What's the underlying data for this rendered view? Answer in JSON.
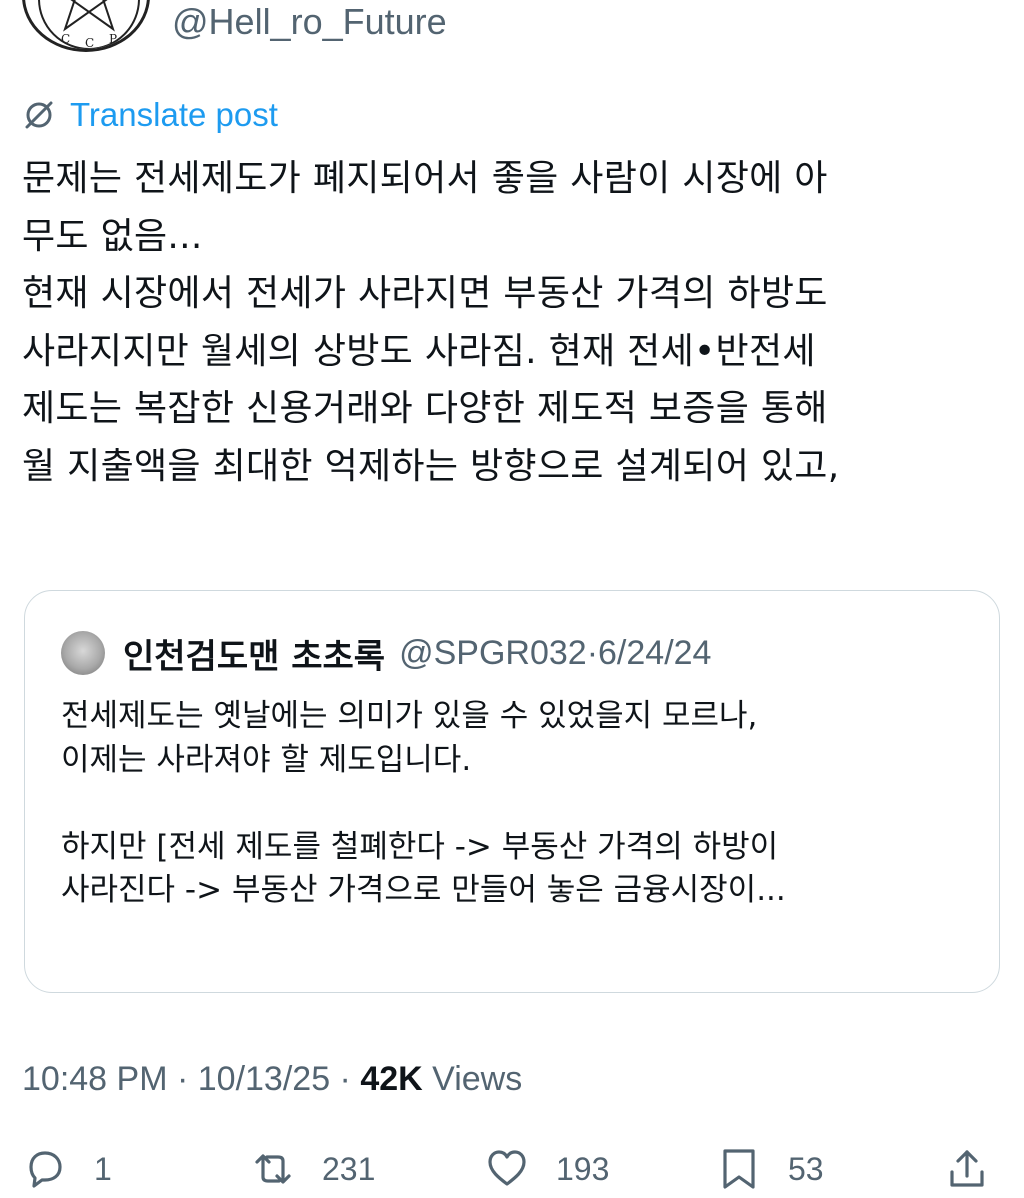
{
  "author": {
    "handle": "@Hell_ro_Future",
    "avatar_letters": [
      "C",
      "C",
      "P"
    ]
  },
  "translate_label": "Translate post",
  "post_text": "문제는 전세제도가 폐지되어서 좋을 사람이 시장에 아\n무도 없음...\n현재 시장에서 전세가 사라지면 부동산 가격의 하방도\n사라지지만 월세의 상방도 사라짐. 현재 전세•반전세\n제도는 복잡한 신용거래와 다양한 제도적 보증을 통해\n월 지출액을 최대한 억제하는 방향으로 설계되어 있고,",
  "quote": {
    "name": "인천검도맨 초초록",
    "handle": "@SPGR032",
    "date": "6/24/24",
    "separator": " · ",
    "text": "전세제도는 옛날에는 의미가 있을 수 있었을지 모르나,\n이제는 사라져야 할 제도입니다.\n\n하지만 [전세 제도를 철폐한다 -> 부동산 가격의 하방이\n사라진다 -> 부동산 가격으로 만들어 놓은 금융시장이..."
  },
  "meta": {
    "time": "10:48 PM",
    "separator": " · ",
    "date": "10/13/25",
    "views_count": "42K",
    "views_label": " Views"
  },
  "actions": {
    "reply_count": "1",
    "repost_count": "231",
    "like_count": "193",
    "bookmark_count": "53"
  },
  "colors": {
    "accent": "#1d9bf0",
    "text_primary": "#0f1419",
    "text_secondary": "#536471",
    "border": "#cfd9de"
  },
  "icons": [
    "translate-icon",
    "reply-icon",
    "repost-icon",
    "like-icon",
    "bookmark-icon",
    "share-icon"
  ]
}
